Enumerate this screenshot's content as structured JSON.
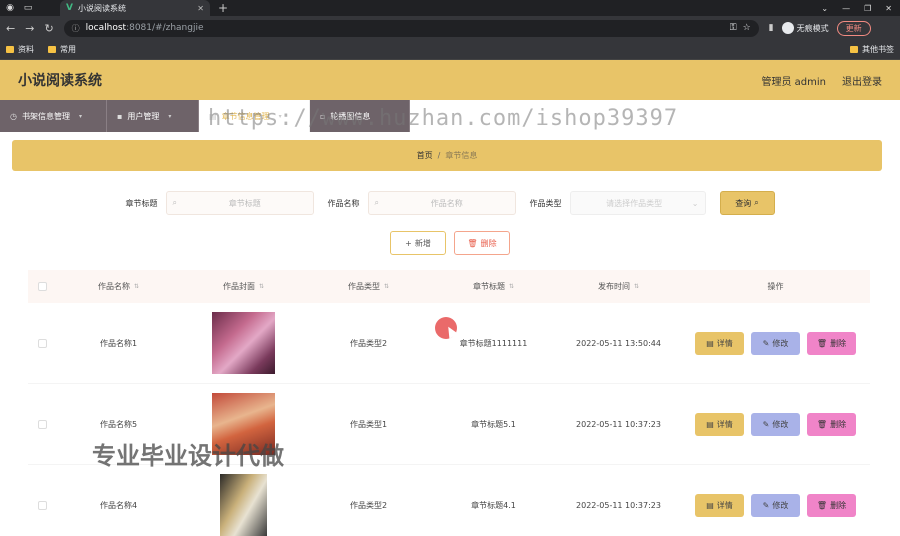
{
  "browser": {
    "tab_title": "小说阅读系统",
    "url_host": "localhost",
    "url_path": ":8081/#/zhangjie",
    "incognito_label": "无痕模式",
    "update_label": "更新",
    "bookmarks": [
      "资料",
      "常用"
    ],
    "bookmark_right": "其他书签"
  },
  "app": {
    "title": "小说阅读系统",
    "user_label": "管理员 admin",
    "logout_label": "退出登录"
  },
  "menu": [
    {
      "label": "书架信息管理",
      "icon": "clock-icon"
    },
    {
      "label": "用户管理",
      "icon": "user-icon"
    },
    {
      "label": "章节信息管理",
      "icon": "list-icon"
    },
    {
      "label": "轮播图信息",
      "icon": "image-icon"
    }
  ],
  "breadcrumb": {
    "home": "首页",
    "separator": "/",
    "current": "章节信息"
  },
  "search": {
    "chapter_label": "章节标题",
    "chapter_placeholder": "章节标题",
    "work_label": "作品名称",
    "work_placeholder": "作品名称",
    "type_label": "作品类型",
    "type_placeholder": "请选择作品类型",
    "query_label": "查询"
  },
  "actions": {
    "add_label": "新增",
    "delete_label": "删除"
  },
  "table": {
    "columns": [
      "作品名称",
      "作品封面",
      "作品类型",
      "章节标题",
      "发布时间",
      "操作"
    ],
    "rows": [
      {
        "name": "作品名称1",
        "type": "作品类型2",
        "chapter": "章节标题1111111",
        "time": "2022-05-11 13:50:44"
      },
      {
        "name": "作品名称5",
        "type": "作品类型1",
        "chapter": "章节标题5.1",
        "time": "2022-05-11 10:37:23"
      },
      {
        "name": "作品名称4",
        "type": "作品类型2",
        "chapter": "章节标题4.1",
        "time": "2022-05-11 10:37:23"
      }
    ],
    "op_detail": "详情",
    "op_edit": "修改",
    "op_delete": "删除"
  },
  "overlay": {
    "url_watermark": "https://www.huzhan.com/ishop39397",
    "cn_watermark": "专业毕业设计代做"
  },
  "colors": {
    "accent": "#e8c468",
    "menu_bg": "#6e6369",
    "edit": "#a9b2e8",
    "delete": "#f084c8"
  }
}
